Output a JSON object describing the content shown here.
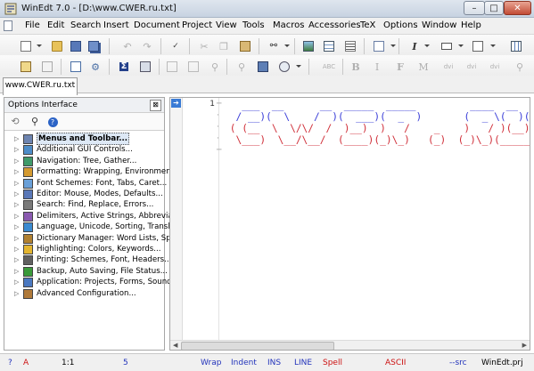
{
  "window": {
    "title": "WinEdt 7.0 - [D:\\www.CWER.ru.txt]",
    "minimize": "–",
    "maximize": "□",
    "close": "✕"
  },
  "menu": [
    "File",
    "Edit",
    "Search",
    "Insert",
    "Document",
    "Project",
    "View",
    "Tools",
    "Macros",
    "Accessories",
    "TeX",
    "Options",
    "Window",
    "Help"
  ],
  "tabs": [
    {
      "label": "www.CWER.ru.txt"
    }
  ],
  "options_panel": {
    "title": "Options Interface",
    "close": "⊠",
    "items": [
      {
        "label": "Menus and Toolbar...",
        "icon": "menu-icon",
        "selected": true
      },
      {
        "label": "Additional GUI Controls...",
        "icon": "controls-icon"
      },
      {
        "label": "Navigation: Tree, Gather...",
        "icon": "navigation-icon"
      },
      {
        "label": "Formatting: Wrapping, Environments...",
        "icon": "formatting-icon"
      },
      {
        "label": "Font Schemes: Font, Tabs, Caret...",
        "icon": "font-icon"
      },
      {
        "label": "Editor: Mouse, Modes, Defaults...",
        "icon": "editor-icon"
      },
      {
        "label": "Search: Find, Replace, Errors...",
        "icon": "search-icon"
      },
      {
        "label": "Delimiters, Active Strings, Abbreviation",
        "icon": "delimiters-icon"
      },
      {
        "label": "Language, Unicode, Sorting, Translatio",
        "icon": "language-icon"
      },
      {
        "label": "Dictionary Manager: Word Lists, Spellin",
        "icon": "dictionary-icon"
      },
      {
        "label": "Highlighting: Colors, Keywords...",
        "icon": "highlighting-icon"
      },
      {
        "label": "Printing: Schemes, Font, Headers...",
        "icon": "printer-icon"
      },
      {
        "label": "Backup, Auto Saving, File Status...",
        "icon": "backup-icon"
      },
      {
        "label": "Application: Projects, Forms, Sounds...",
        "icon": "application-icon"
      },
      {
        "label": "Advanced Configuration...",
        "icon": "advanced-config-icon"
      }
    ]
  },
  "editor": {
    "line_numbers": [
      "1"
    ],
    "lines": [
      [
        {
          "t": "   ___  __      __  _____  _____         ____  __  __",
          "c": "c-blue"
        }
      ],
      [
        {
          "t": "  / __)(  \\    /  )(  ___)(  _  )       (  _ \\(  )(  )",
          "c": "c-blue"
        }
      ],
      [
        {
          "t": " ( (__  \\  \\/\\/  /  )__)  )   /    _    )   / )(__)(",
          "c": "c-red"
        }
      ],
      [
        {
          "t": "  \\___)  \\__/\\__/  (____)(_)\\_)   (_)  (_)\\_)(______)",
          "c": "c-red"
        }
      ]
    ]
  },
  "status": {
    "help": "?",
    "mode": "A",
    "position": "1:1",
    "count": "5",
    "wrap": "Wrap",
    "indent": "Indent",
    "ins": "INS",
    "line": "LINE",
    "spell": "Spell",
    "encoding": "ASCII",
    "src": "--src",
    "project": "WinEdt.prj"
  },
  "colors": {
    "ascii_blue": "#3b3fd8",
    "ascii_red": "#d0303a",
    "status_blue": "#2233bb",
    "status_red": "#cc1111"
  }
}
